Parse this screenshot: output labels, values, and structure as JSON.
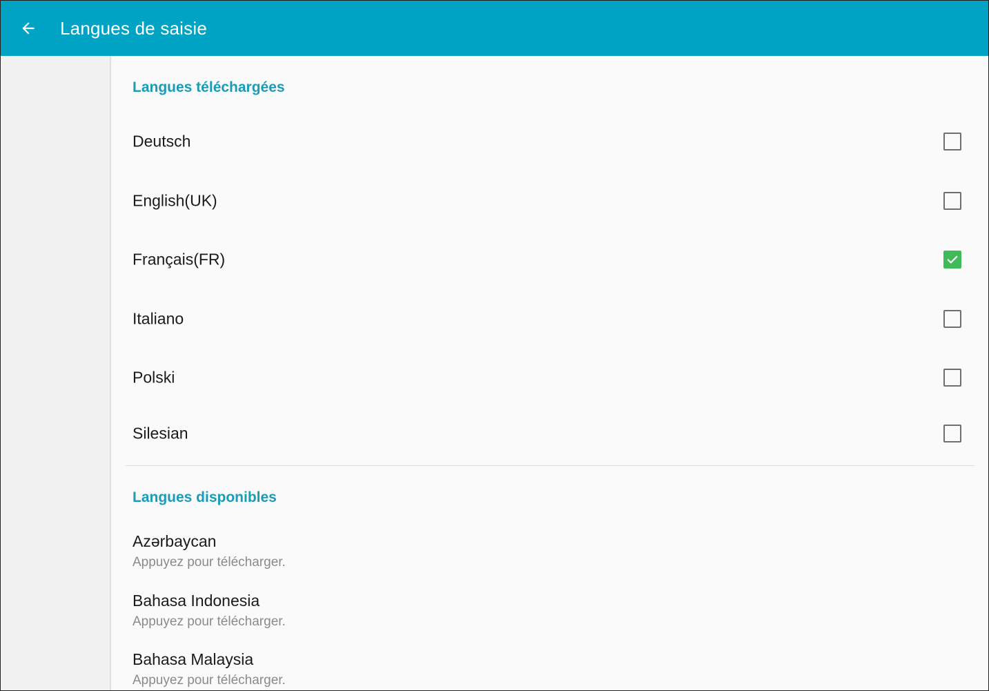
{
  "app_bar": {
    "title": "Langues de saisie",
    "background": "#00a3c4",
    "back_icon": "arrow-left-icon"
  },
  "downloaded": {
    "header": "Langues téléchargées",
    "items": [
      {
        "label": "Deutsch",
        "checked": false
      },
      {
        "label": "English(UK)",
        "checked": false
      },
      {
        "label": "Français(FR)",
        "checked": true
      },
      {
        "label": "Italiano",
        "checked": false
      },
      {
        "label": "Polski",
        "checked": false
      },
      {
        "label": "Silesian",
        "checked": false
      }
    ]
  },
  "available": {
    "header": "Langues disponibles",
    "items": [
      {
        "label": "Azərbaycan",
        "subtitle": "Appuyez pour télécharger."
      },
      {
        "label": "Bahasa Indonesia",
        "subtitle": "Appuyez pour télécharger."
      },
      {
        "label": "Bahasa Malaysia",
        "subtitle": "Appuyez pour télécharger."
      }
    ]
  },
  "colors": {
    "accent": "#1a9bb8",
    "checkbox_checked": "#3fbb57"
  }
}
